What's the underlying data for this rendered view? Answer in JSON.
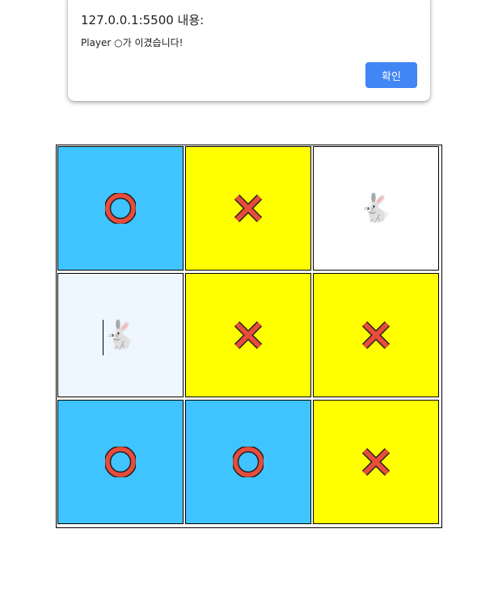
{
  "alert": {
    "origin": "127.0.0.1:5500 내용:",
    "message": "Player ○가 이겼습니다!",
    "ok_label": "확인",
    "ok_color": "#4285f4"
  },
  "board": {
    "cells": [
      {
        "state": "o",
        "mark": "O"
      },
      {
        "state": "x",
        "mark": "X"
      },
      {
        "state": "empty",
        "mark": "🐇"
      },
      {
        "state": "hover",
        "mark": "🐇"
      },
      {
        "state": "x",
        "mark": "X"
      },
      {
        "state": "x",
        "mark": "X"
      },
      {
        "state": "o",
        "mark": "O"
      },
      {
        "state": "o",
        "mark": "O"
      },
      {
        "state": "x",
        "mark": "X"
      }
    ],
    "colors": {
      "o_cell": "#40c4ff",
      "x_cell": "#ffff00",
      "empty_cell": "#ffffff",
      "hover_cell": "#eef6ff",
      "mark_red": "#e74c3c"
    },
    "winner": "O"
  }
}
